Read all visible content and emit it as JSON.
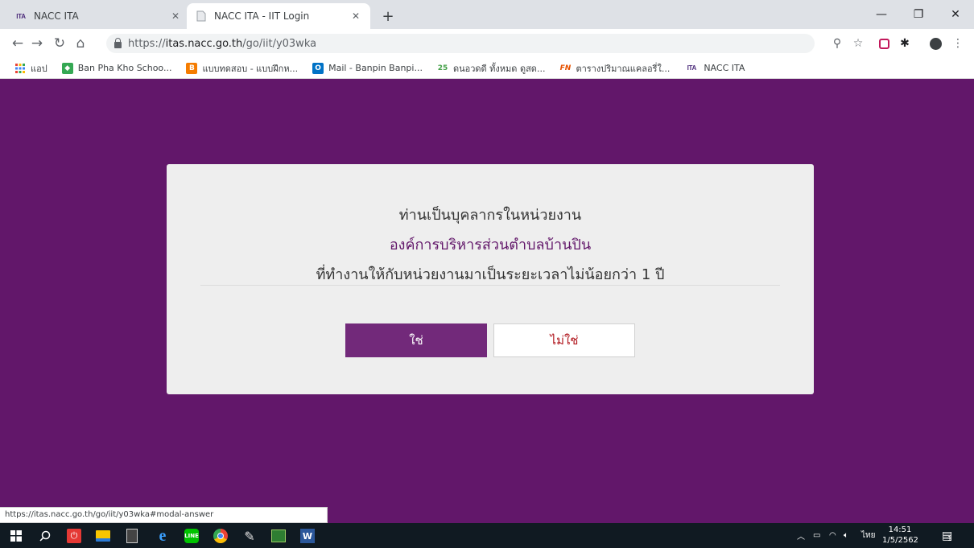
{
  "browser": {
    "tabs": [
      {
        "title": "NACC ITA",
        "favicon": "ita-logo",
        "active": false
      },
      {
        "title": "NACC ITA - IIT Login",
        "favicon": "page-icon",
        "active": true
      }
    ],
    "url_prefix": "https://",
    "url_host": "itas.nacc.go.th",
    "url_path": "/go/iit/y03wka",
    "bookmarks": [
      {
        "label": "แอป",
        "icon": "apps-grid-icon"
      },
      {
        "label": "Ban Pha Kho Schoo...",
        "icon": "maps-icon"
      },
      {
        "label": "แบบทดสอบ - แบบฝึกห...",
        "icon": "blogger-icon"
      },
      {
        "label": "Mail - Banpin Banpi...",
        "icon": "outlook-icon"
      },
      {
        "label": "ดนอวดดี ทั้งหมด ดูสด...",
        "icon": "th25-icon"
      },
      {
        "label": "ตารางปริมาณแคลอรี่ใ...",
        "icon": "fn-icon"
      },
      {
        "label": "NACC ITA",
        "icon": "ita-logo"
      }
    ],
    "status_url": "https://itas.nacc.go.th/go/iit/y03wka#modal-answer"
  },
  "modal": {
    "line1": "ท่านเป็นบุคลากรในหน่วยงาน",
    "line2": "องค์การบริหารส่วนตำบลบ้านปิน",
    "line3": "ที่ทำงานให้กับหน่วยงานมาเป็นระยะเวลาไม่น้อยกว่า 1 ปี",
    "yes_label": "ใช่",
    "no_label": "ไม่ใช่"
  },
  "taskbar": {
    "language": "ไทย",
    "time": "14:51",
    "date": "1/5/2562",
    "notification_count": "1"
  },
  "colors": {
    "page_background": "#62176a",
    "yes_button": "#72297a",
    "no_text": "#b0151c"
  }
}
